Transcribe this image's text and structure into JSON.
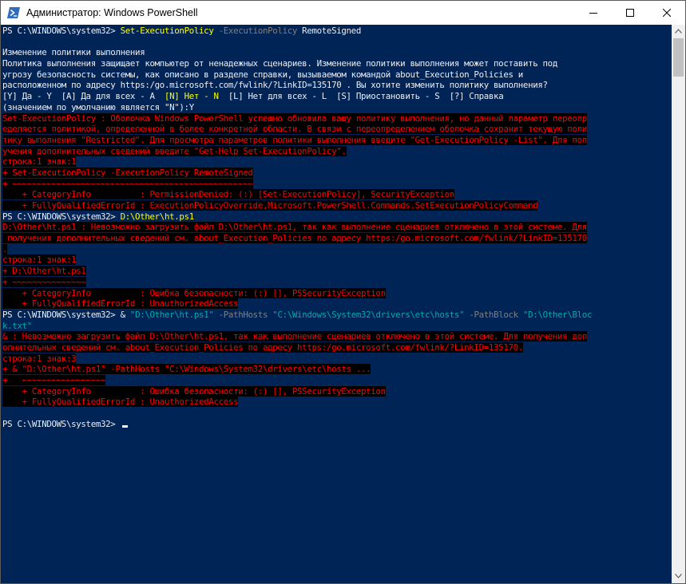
{
  "window": {
    "title": "Администратор: Windows PowerShell",
    "icon": "powershell-icon"
  },
  "controls": {
    "minimize": "minimize-icon",
    "maximize": "maximize-icon",
    "close": "close-icon"
  },
  "colors": {
    "background": "#012456",
    "text": "#eeedf0",
    "command": "#ffff00",
    "parameter": "#808080",
    "string": "#00aaaa",
    "error": "#ff0000",
    "error_background": "#000000"
  },
  "console": {
    "lines": [
      [
        {
          "t": "PS C:\\WINDOWS\\system32> ",
          "c": ""
        },
        {
          "t": "Set-ExecutionPolicy",
          "c": "cmd"
        },
        {
          "t": " -ExecutionPolicy",
          "c": "param"
        },
        {
          "t": " RemoteSigned",
          "c": ""
        }
      ],
      [
        {
          "t": "",
          "c": ""
        }
      ],
      [
        {
          "t": "Изменение политики выполнения",
          "c": ""
        }
      ],
      [
        {
          "t": "Политика выполнения защищает компьютер от ненадежных сценариев. Изменение политики выполнения может поставить под",
          "c": ""
        }
      ],
      [
        {
          "t": "угрозу безопасность системы, как описано в разделе справки, вызываемом командой about_Execution_Policies и",
          "c": ""
        }
      ],
      [
        {
          "t": "расположенном по адресу https:/go.microsoft.com/fwlink/?LinkID=135170 . Вы хотите изменить политику выполнения?",
          "c": ""
        }
      ],
      [
        {
          "t": "[Y] Да - Y  [A] Да для всех - A  ",
          "c": ""
        },
        {
          "t": "[N] Нет - N",
          "c": "hl"
        },
        {
          "t": "  [L] Нет для всех - L  [S] Приостановить - S  [?] Справка",
          "c": ""
        }
      ],
      [
        {
          "t": "(значением по умолчанию является \"N\"):Y",
          "c": ""
        }
      ],
      [
        {
          "t": "Set-ExecutionPolicy : Оболочка Windows PowerShell успешно обновила вашу политику выполнения, но данный параметр переопр",
          "c": "err"
        }
      ],
      [
        {
          "t": "еделяется политикой, определенной в более конкретной области. В связи с переопределением оболочка сохранит текущую поли",
          "c": "err"
        }
      ],
      [
        {
          "t": "тику выполнения \"Restricted\". Для просмотра параметров политики выполнения введите \"Get-ExecutionPolicy -List\". Для пол",
          "c": "err"
        }
      ],
      [
        {
          "t": "учения дополнительных сведений введите \"Get-Help Set-ExecutionPolicy\".",
          "c": "err"
        }
      ],
      [
        {
          "t": "строка:1 знак:1",
          "c": "err"
        }
      ],
      [
        {
          "t": "+ Set-ExecutionPolicy -ExecutionPolicy RemoteSigned",
          "c": "err"
        }
      ],
      [
        {
          "t": "+ ~~~~~~~~~~~~~~~~~~~~~~~~~~~~~~~~~~~~~~~~~~~~~~~~~",
          "c": "err"
        }
      ],
      [
        {
          "t": "    + CategoryInfo          : PermissionDenied: (:) [Set-ExecutionPolicy], SecurityException",
          "c": "err"
        }
      ],
      [
        {
          "t": "    + FullyQualifiedErrorId : ExecutionPolicyOverride,Microsoft.PowerShell.Commands.SetExecutionPolicyCommand",
          "c": "err"
        }
      ],
      [
        {
          "t": "PS C:\\WINDOWS\\system32> ",
          "c": ""
        },
        {
          "t": "D:\\Other\\ht.ps1",
          "c": "cmd"
        }
      ],
      [
        {
          "t": "D:\\Other\\ht.ps1 : Невозможно загрузить файл D:\\Other\\ht.ps1, так как выполнение сценариев отключено в этой системе. Для",
          "c": "err"
        }
      ],
      [
        {
          "t": " получения дополнительных сведений см. about_Execution_Policies по адресу https:/go.microsoft.com/fwlink/?LinkID=135170",
          "c": "err"
        }
      ],
      [
        {
          "t": ".",
          "c": "err"
        }
      ],
      [
        {
          "t": "строка:1 знак:1",
          "c": "err"
        }
      ],
      [
        {
          "t": "+ D:\\Other\\ht.ps1",
          "c": "err"
        }
      ],
      [
        {
          "t": "+ ~~~~~~~~~~~~~~~",
          "c": "err"
        }
      ],
      [
        {
          "t": "    + CategoryInfo          : Ошибка безопасности: (:) [], PSSecurityException",
          "c": "err"
        }
      ],
      [
        {
          "t": "    + FullyQualifiedErrorId : UnauthorizedAccess",
          "c": "err"
        }
      ],
      [
        {
          "t": "PS C:\\WINDOWS\\system32> & ",
          "c": ""
        },
        {
          "t": "\"D:\\Other\\ht.ps1\"",
          "c": "str"
        },
        {
          "t": " -PathHosts ",
          "c": "param"
        },
        {
          "t": "\"C:\\Windows\\System32\\drivers\\etc\\hosts\"",
          "c": "str"
        },
        {
          "t": " -PathBlock ",
          "c": "param"
        },
        {
          "t": "\"D:\\Other\\Bloc",
          "c": "str"
        }
      ],
      [
        {
          "t": "k.txt\"",
          "c": "str"
        }
      ],
      [
        {
          "t": "& : Невозможно загрузить файл D:\\Other\\ht.ps1, так как выполнение сценариев отключено в этой системе. Для получения доп",
          "c": "err"
        }
      ],
      [
        {
          "t": "олнительных сведений см. about_Execution_Policies по адресу https:/go.microsoft.com/fwlink/?LinkID=135170.",
          "c": "err"
        }
      ],
      [
        {
          "t": "строка:1 знак:3",
          "c": "err"
        }
      ],
      [
        {
          "t": "+ & \"D:\\Other\\ht.ps1\" -PathHosts \"C:\\Windows\\System32\\drivers\\etc\\hosts ...",
          "c": "err"
        }
      ],
      [
        {
          "t": "+   ~~~~~~~~~~~~~~~~~",
          "c": "err"
        }
      ],
      [
        {
          "t": "    + CategoryInfo          : Ошибка безопасности: (:) [], PSSecurityException",
          "c": "err"
        }
      ],
      [
        {
          "t": "    + FullyQualifiedErrorId : UnauthorizedAccess",
          "c": "err"
        }
      ],
      [
        {
          "t": "",
          "c": ""
        }
      ],
      [
        {
          "t": "PS C:\\WINDOWS\\system32> ",
          "c": ""
        }
      ]
    ]
  }
}
